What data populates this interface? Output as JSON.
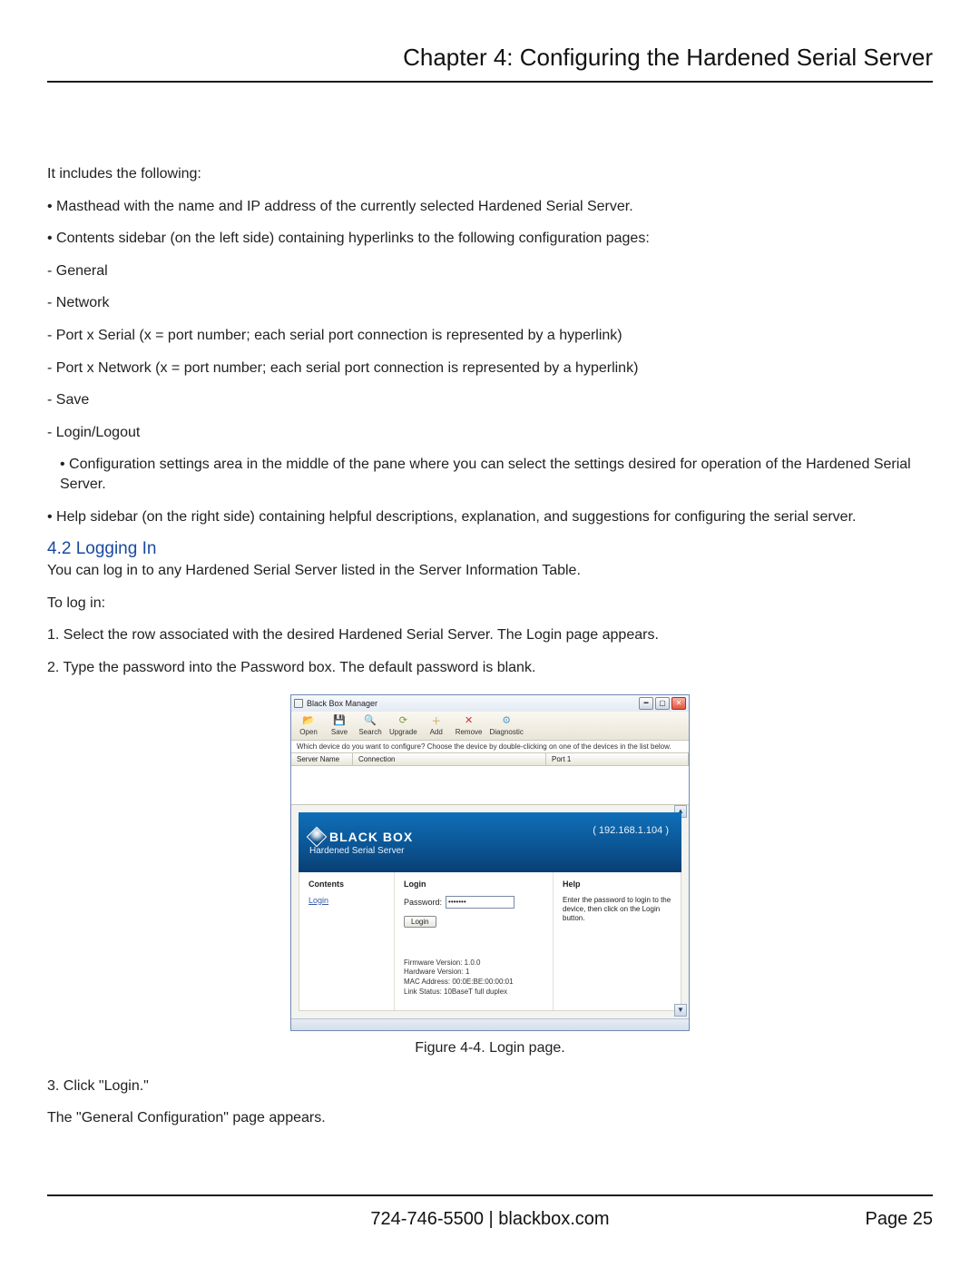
{
  "header": {
    "chapter_title": "Chapter 4: Configuring the Hardened Serial Server"
  },
  "body": {
    "intro": "It includes the following:",
    "items": [
      "• Masthead with the name and IP address of the currently selected Hardened Serial Server.",
      "• Contents sidebar (on the left side) containing hyperlinks to the following configuration pages:",
      "- General",
      "- Network",
      "- Port x Serial (x = port number; each serial port connection is represented by a hyperlink)",
      "- Port x Network (x = port number; each serial port connection is represented by a hyperlink)",
      "- Save",
      "- Login/Logout",
      "• Configuration settings area in the middle of the pane where you can select the settings desired for operation of the Hardened Serial Server.",
      "• Help sidebar (on the right side) containing helpful descriptions, explanation, and suggestions for configuring the serial server."
    ],
    "section_head": "4.2 Logging In",
    "p1": "You can log in to any Hardened Serial Server listed in the Server Information Table.",
    "p2": "To log in:",
    "step1": "1. Select the row associated with the desired Hardened Serial Server. The Login page appears.",
    "step2": "2. Type the password into the Password box. The default password is blank.",
    "step3": "3. Click \"Login.\"",
    "p3": "The \"General Configuration\" page appears."
  },
  "figure": {
    "caption": "Figure 4-4. Login page.",
    "app": {
      "title": "Black Box Manager",
      "hint": "Which device do you want to configure? Choose the device by double-clicking on one of the devices in the list below.",
      "toolbar": {
        "open": "Open",
        "save": "Save",
        "search": "Search",
        "upgrade": "Upgrade",
        "add": "Add",
        "remove": "Remove",
        "diag": "Diagnostic"
      },
      "columns": {
        "server_name": "Server Name",
        "connection": "Connection",
        "port1": "Port 1"
      },
      "banner": {
        "logo_text": "BLACK BOX",
        "subtitle": "Hardened Serial Server",
        "ip": "( 192.168.1.104 )"
      },
      "contents": {
        "head": "Contents",
        "login_link": "Login"
      },
      "login_panel": {
        "head": "Login",
        "password_label": "Password:",
        "password_value": "•••••••",
        "button": "Login",
        "fw": "Firmware Version: 1.0.0",
        "hw": "Hardware Version: 1",
        "mac": "MAC Address: 00:0E:BE:00:00:01",
        "link": "Link Status: 10BaseT full duplex"
      },
      "help_panel": {
        "head": "Help",
        "text": "Enter the password to login to the device, then click on the Login button."
      }
    }
  },
  "footer": {
    "center": "724-746-5500   |   blackbox.com",
    "page": "Page 25"
  }
}
